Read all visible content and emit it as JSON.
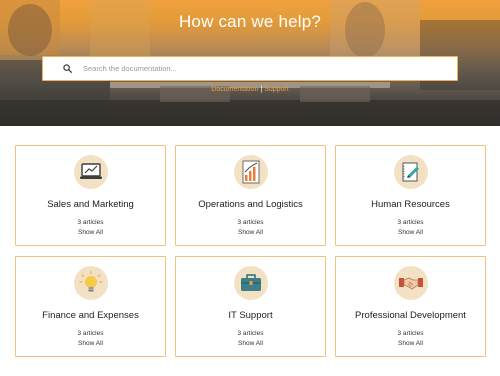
{
  "hero": {
    "title": "How can we help?",
    "search_placeholder": "Search the documentation...",
    "breadcrumb": [
      "Documentation",
      "Support"
    ],
    "separator": "|"
  },
  "cards": [
    {
      "title": "Sales and Marketing",
      "count": "3 articles",
      "link": "Show All",
      "icon": "laptop-chart-icon"
    },
    {
      "title": "Operations and Logistics",
      "count": "3 articles",
      "link": "Show All",
      "icon": "bar-chart-icon"
    },
    {
      "title": "Human Resources",
      "count": "3 articles",
      "link": "Show All",
      "icon": "notebook-pen-icon"
    },
    {
      "title": "Finance and Expenses",
      "count": "3 articles",
      "link": "Show All",
      "icon": "lightbulb-icon"
    },
    {
      "title": "IT Support",
      "count": "3 articles",
      "link": "Show All",
      "icon": "briefcase-icon"
    },
    {
      "title": "Professional Development",
      "count": "3 articles",
      "link": "Show All",
      "icon": "handshake-icon"
    }
  ],
  "colors": {
    "accent": "#f3b15a",
    "icon_bg": "#f3e1c3",
    "link": "#e8a04a"
  }
}
